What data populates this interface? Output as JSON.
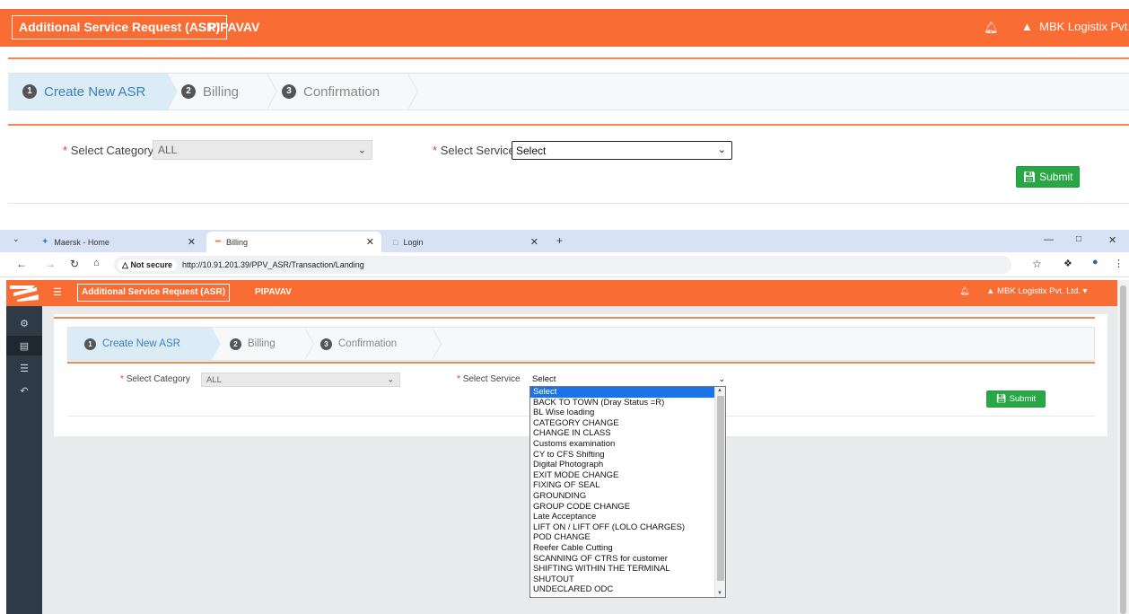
{
  "top": {
    "header": {
      "app_title": "Additional Service Request (ASR)",
      "port": "PIPAVAV",
      "user": "MBK Logistix Pvt. L"
    },
    "wizard": [
      {
        "num": "1",
        "label": "Create New ASR"
      },
      {
        "num": "2",
        "label": "Billing"
      },
      {
        "num": "3",
        "label": "Confirmation"
      }
    ],
    "form": {
      "required_mark": "*",
      "category_label": "Select Category",
      "category_value": "ALL",
      "service_label": "Select Service",
      "service_value": "Select",
      "submit_label": "Submit"
    }
  },
  "browser": {
    "tabs": [
      {
        "title": "Maersk - Home"
      },
      {
        "title": "Billing"
      },
      {
        "title": "Login"
      }
    ],
    "security_label": "Not secure",
    "url": "http://10.91.201.39/PPV_ASR/Transaction/Landing"
  },
  "inner": {
    "header": {
      "app_title": "Additional Service Request (ASR)",
      "port": "PIPAVAV",
      "user": "MBK Logistix Pvt. Ltd."
    },
    "wizard": [
      {
        "num": "1",
        "label": "Create New ASR"
      },
      {
        "num": "2",
        "label": "Billing"
      },
      {
        "num": "3",
        "label": "Confirmation"
      }
    ],
    "form": {
      "required_mark": "*",
      "category_label": "Select Category",
      "category_value": "ALL",
      "service_label": "Select Service",
      "service_value": "Select",
      "submit_label": "Submit"
    },
    "service_options": [
      "Select",
      "BACK TO TOWN (Dray Status =R)",
      "BL Wise loading",
      "CATEGORY CHANGE",
      "CHANGE IN CLASS",
      "Customs examination",
      "CY to CFS Shifting",
      "Digital Photograph",
      "EXIT MODE CHANGE",
      "FIXING OF SEAL",
      "GROUNDING",
      "GROUP CODE CHANGE",
      "Late Acceptance",
      "LIFT ON / LIFT OFF (LOLO CHARGES)",
      "POD CHANGE",
      "Reefer Cable Cutting",
      "SCANNING OF CTRS for customer",
      "SHIFTING WITHIN THE TERMINAL",
      "SHUTOUT",
      "UNDECLARED ODC"
    ],
    "selected_option": "Select"
  },
  "colors": {
    "accent": "#f96c34",
    "sidebar": "#2e3a46",
    "submit": "#28a745",
    "selected": "#1a73e8"
  }
}
